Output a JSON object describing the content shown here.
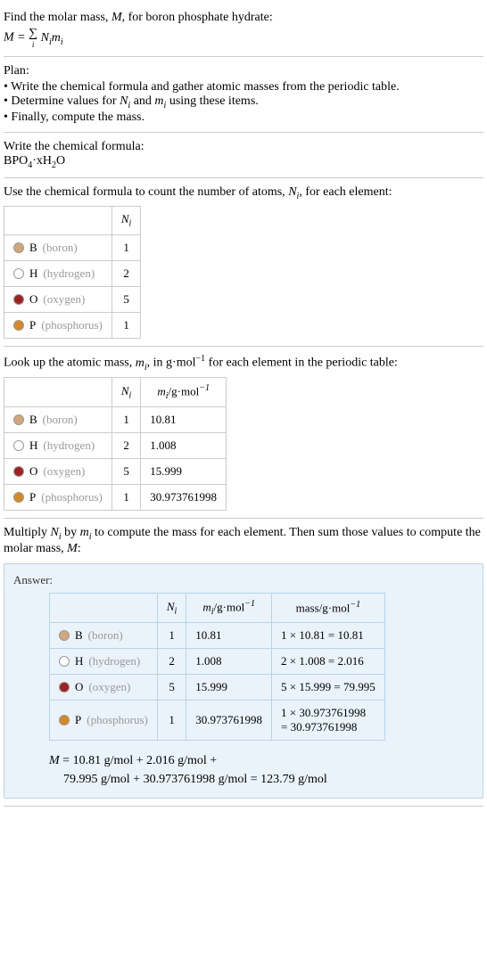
{
  "section1": {
    "line1": "Find the molar mass, ",
    "line1_var": "M",
    "line1_end": ", for boron phosphate hydrate:",
    "formula_lhs": "M",
    "formula_eq": " = ",
    "formula_rhs": "N",
    "formula_rhs2": "m",
    "sigma_sub": "i"
  },
  "section2": {
    "title": "Plan:",
    "b1a": "• Write the chemical formula and gather atomic masses from the periodic table.",
    "b2a": "• Determine values for ",
    "b2b": "N",
    "b2c": " and ",
    "b2d": "m",
    "b2e": " using these items.",
    "b3": "• Finally, compute the mass."
  },
  "section3": {
    "title": "Write the chemical formula:",
    "formula_b": "BPO",
    "formula_4": "4",
    "formula_dot": "·xH",
    "formula_2": "2",
    "formula_o": "O"
  },
  "section4": {
    "title_a": "Use the chemical formula to count the number of atoms, ",
    "title_var": "N",
    "title_b": ", for each element:",
    "header_ni": "N",
    "elements": [
      {
        "sym": "B",
        "name": "(boron)",
        "color": "#d4a876",
        "ni": "1"
      },
      {
        "sym": "H",
        "name": "(hydrogen)",
        "color": "#ffffff",
        "ni": "2"
      },
      {
        "sym": "O",
        "name": "(oxygen)",
        "color": "#a02020",
        "ni": "5"
      },
      {
        "sym": "P",
        "name": "(phosphorus)",
        "color": "#d88820",
        "ni": "1"
      }
    ]
  },
  "section5": {
    "title_a": "Look up the atomic mass, ",
    "title_var": "m",
    "title_b": ", in g·mol",
    "title_exp": "−1",
    "title_c": " for each element in the periodic table:",
    "header_ni": "N",
    "header_mi_a": "m",
    "header_mi_b": "/g·mol",
    "header_mi_exp": "−1",
    "elements": [
      {
        "sym": "B",
        "name": "(boron)",
        "color": "#d4a876",
        "ni": "1",
        "mi": "10.81"
      },
      {
        "sym": "H",
        "name": "(hydrogen)",
        "color": "#ffffff",
        "ni": "2",
        "mi": "1.008"
      },
      {
        "sym": "O",
        "name": "(oxygen)",
        "color": "#a02020",
        "ni": "5",
        "mi": "15.999"
      },
      {
        "sym": "P",
        "name": "(phosphorus)",
        "color": "#d88820",
        "ni": "1",
        "mi": "30.973761998"
      }
    ]
  },
  "section6": {
    "title_a": "Multiply ",
    "title_n": "N",
    "title_b": " by ",
    "title_m": "m",
    "title_c": " to compute the mass for each element. Then sum those values to compute the molar mass, ",
    "title_mvar": "M",
    "title_d": ":",
    "answer_label": "Answer:",
    "header_ni": "N",
    "header_mi_a": "m",
    "header_mi_b": "/g·mol",
    "header_mi_exp": "−1",
    "header_mass_a": "mass/g·mol",
    "header_mass_exp": "−1",
    "elements": [
      {
        "sym": "B",
        "name": "(boron)",
        "color": "#d4a876",
        "ni": "1",
        "mi": "10.81",
        "mass": "1 × 10.81 = 10.81"
      },
      {
        "sym": "H",
        "name": "(hydrogen)",
        "color": "#ffffff",
        "ni": "2",
        "mi": "1.008",
        "mass": "2 × 1.008 = 2.016"
      },
      {
        "sym": "O",
        "name": "(oxygen)",
        "color": "#a02020",
        "ni": "5",
        "mi": "15.999",
        "mass": "5 × 15.999 = 79.995"
      },
      {
        "sym": "P",
        "name": "(phosphorus)",
        "color": "#d88820",
        "ni": "1",
        "mi": "30.973761998",
        "mass_a": "1 × 30.973761998",
        "mass_b": "= 30.973761998"
      }
    ],
    "final_a": "M",
    "final_b": " = 10.81 g/mol + 2.016 g/mol +",
    "final_c": "79.995 g/mol + 30.973761998 g/mol = 123.79 g/mol"
  }
}
